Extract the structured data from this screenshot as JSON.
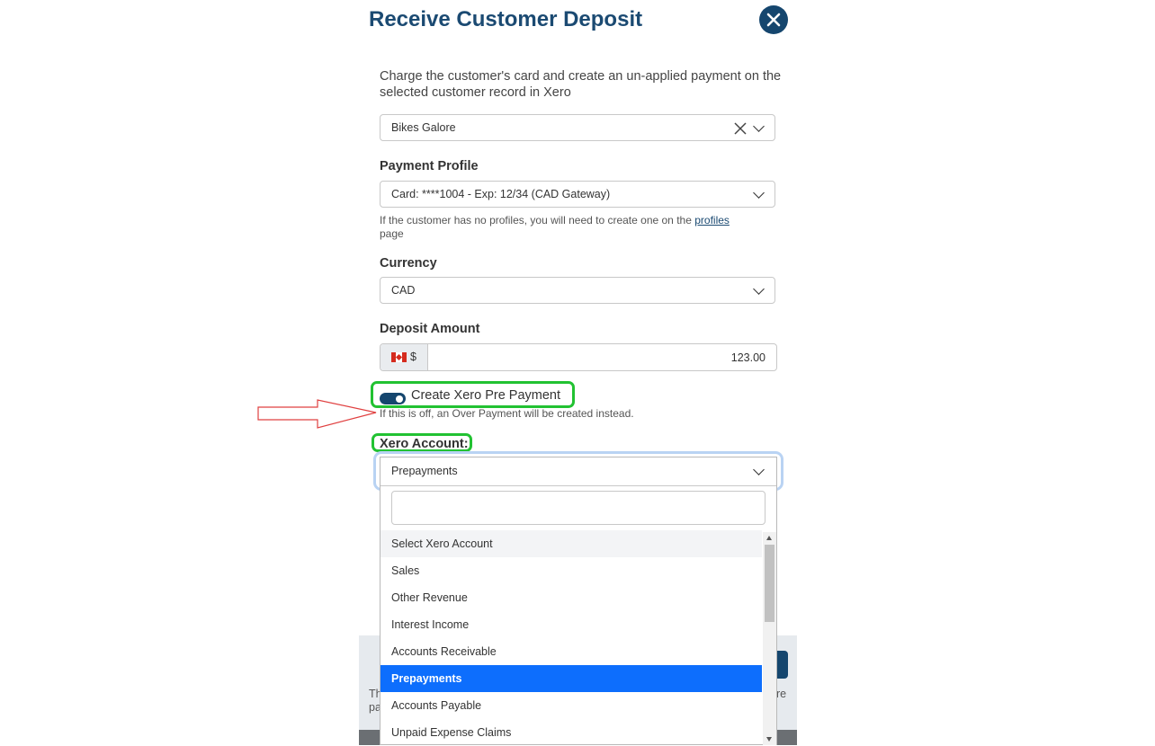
{
  "modal": {
    "title": "Receive Customer Deposit",
    "description": "Charge the customer's card and create an un-applied payment on the selected customer record in Xero"
  },
  "customer": {
    "value": "Bikes Galore"
  },
  "payment_profile": {
    "label": "Payment Profile",
    "value": "Card: ****1004 - Exp: 12/34 (CAD Gateway)",
    "help_prefix": "If the customer has no profiles, you will need to create one on the",
    "help_link": "profiles",
    "help_suffix": "page"
  },
  "currency": {
    "label": "Currency",
    "value": "CAD"
  },
  "deposit": {
    "label": "Deposit Amount",
    "currency_symbol": "$",
    "amount": "123.00"
  },
  "prepayment_toggle": {
    "label": "Create Xero Pre Payment",
    "checked": true,
    "help": "If this is off, an Over Payment will be created instead."
  },
  "xero_account": {
    "label": "Xero Account:",
    "selected": "Prepayments",
    "search_placeholder": "",
    "options": [
      "Select Xero Account",
      "Sales",
      "Other Revenue",
      "Interest Income",
      "Accounts Receivable",
      "Prepayments",
      "Accounts Payable",
      "Unpaid Expense Claims"
    ]
  },
  "behind_text": {
    "left_top": "Th",
    "left_bottom": "pa",
    "right": "re"
  },
  "colors": {
    "primary": "#15466e",
    "title": "#1b4a72",
    "selected_option": "#0d6efd",
    "highlight": "#22c232",
    "annotation_arrow": "#e04040"
  },
  "icons": {
    "close": "close-icon",
    "clear": "clear-icon",
    "chevron": "chevron-down-icon",
    "flag": "canada-flag-icon",
    "arrow": "annotation-arrow-icon"
  }
}
